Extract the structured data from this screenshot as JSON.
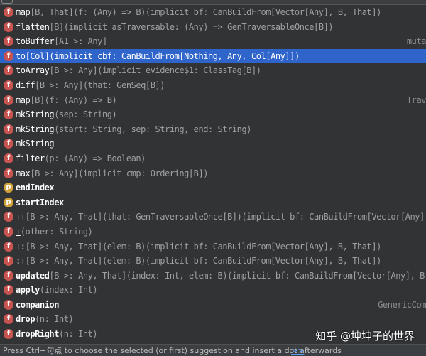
{
  "colors": {
    "background": "#313335",
    "selected_row": "#2f65ca",
    "method_icon": "#c75450",
    "property_icon": "#d2a23a",
    "signature_text": "#a0a0a0",
    "link": "#589df6"
  },
  "suggestions": [
    {
      "icon": "f",
      "name": "map",
      "sig": "[B, That](f: (Any) => B)(implicit bf: CanBuildFrom[Vector[Any], B, That])",
      "right": ""
    },
    {
      "icon": "f",
      "name": "flatten",
      "sig": "[B](implicit asTraversable: (Any) => GenTraversableOnce[B])",
      "right": ""
    },
    {
      "icon": "f",
      "name": "toBuffer",
      "sig": "[A1 >: Any]",
      "right": "muta"
    },
    {
      "icon": "f",
      "name": "to",
      "sig": "[Col](implicit cbf: CanBuildFrom[Nothing, Any, Col[Any]])",
      "right": ""
    },
    {
      "icon": "f",
      "name": "toArray",
      "sig": "[B >: Any](implicit evidence$1: ClassTag[B])",
      "right": ""
    },
    {
      "icon": "f",
      "name": "diff",
      "sig": "[B >: Any](that: GenSeq[B])",
      "right": ""
    },
    {
      "icon": "f",
      "name": "map",
      "sig": "[B](f: (Any) => B)",
      "right": "Trav"
    },
    {
      "icon": "f",
      "name": "mkString",
      "sig": "(sep: String)",
      "right": ""
    },
    {
      "icon": "f",
      "name": "mkString",
      "sig": "(start: String, sep: String, end: String)",
      "right": ""
    },
    {
      "icon": "f",
      "name": "mkString",
      "sig": "",
      "right": ""
    },
    {
      "icon": "f",
      "name": "filter",
      "sig": "(p: (Any) => Boolean)",
      "right": ""
    },
    {
      "icon": "f",
      "name": "max",
      "sig": "[B >: Any](implicit cmp: Ordering[B])",
      "right": ""
    },
    {
      "icon": "p",
      "name": "endIndex",
      "sig": "",
      "right": ""
    },
    {
      "icon": "p",
      "name": "startIndex",
      "sig": "",
      "right": ""
    },
    {
      "icon": "f",
      "name": "++",
      "sig": "[B >: Any, That](that: GenTraversableOnce[B])(implicit bf: CanBuildFrom[Vector[Any], B, That])",
      "right": ""
    },
    {
      "icon": "f",
      "name": "+",
      "sig": "(other: String)",
      "right": ""
    },
    {
      "icon": "f",
      "name": "+:",
      "sig": "[B >: Any, That](elem: B)(implicit bf: CanBuildFrom[Vector[Any], B, That])",
      "right": ""
    },
    {
      "icon": "f",
      "name": ":+",
      "sig": "[B >: Any, That](elem: B)(implicit bf: CanBuildFrom[Vector[Any], B, That])",
      "right": ""
    },
    {
      "icon": "f",
      "name": "updated",
      "sig": "[B >: Any, That](index: Int, elem: B)(implicit bf: CanBuildFrom[Vector[Any], B, That])",
      "right": ""
    },
    {
      "icon": "f",
      "name": "apply",
      "sig": "(index: Int)",
      "right": ""
    },
    {
      "icon": "f",
      "name": "companion",
      "sig": "",
      "right": "GenericCom"
    },
    {
      "icon": "f",
      "name": "drop",
      "sig": "(n: Int)",
      "right": ""
    },
    {
      "icon": "f",
      "name": "dropRight",
      "sig": "(n: Int)",
      "right": ""
    }
  ],
  "status": {
    "hint": "Press Ctrl+句点 to choose the selected (or first) suggestion and insert a dot afterwards",
    "more_link": ">>"
  },
  "watermark": "知乎 @坤坤子的世界"
}
